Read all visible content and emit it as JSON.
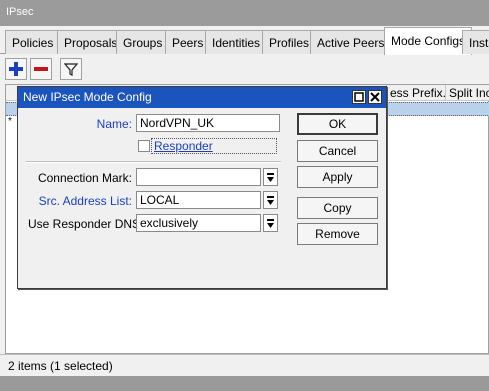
{
  "window": {
    "title": "IPsec"
  },
  "tabs": [
    {
      "label": "Policies"
    },
    {
      "label": "Proposals"
    },
    {
      "label": "Groups"
    },
    {
      "label": "Peers"
    },
    {
      "label": "Identities"
    },
    {
      "label": "Profiles"
    },
    {
      "label": "Active Peers"
    },
    {
      "label": "Mode Configs",
      "active": true
    },
    {
      "label": "Insta"
    }
  ],
  "toolbar": {
    "add_icon": "plus-icon",
    "remove_icon": "minus-icon",
    "filter_icon": "filter-icon"
  },
  "table": {
    "columns": [
      "ess Prefix...",
      "Split Inclu"
    ],
    "rows": [
      {
        "marker": "",
        "selected": true
      },
      {
        "marker": "*",
        "selected": false
      }
    ]
  },
  "status": {
    "text": "2 items (1 selected)"
  },
  "dialog": {
    "title": "New IPsec Mode Config",
    "name_label": "Name:",
    "name_value": "NordVPN_UK",
    "responder_label": "Responder",
    "responder_checked": false,
    "connection_mark_label": "Connection Mark:",
    "connection_mark_value": "",
    "src_address_list_label": "Src. Address List:",
    "src_address_list_value": "LOCAL",
    "use_responder_dns_label": "Use Responder DNS:",
    "use_responder_dns_value": "exclusively",
    "buttons": {
      "ok": "OK",
      "cancel": "Cancel",
      "apply": "Apply",
      "copy": "Copy",
      "remove": "Remove"
    }
  },
  "colors": {
    "dialog_title_bg": "#1c54bd",
    "selected_row": "#b9d1ea",
    "field_label_blue": "#1a3fc0"
  }
}
